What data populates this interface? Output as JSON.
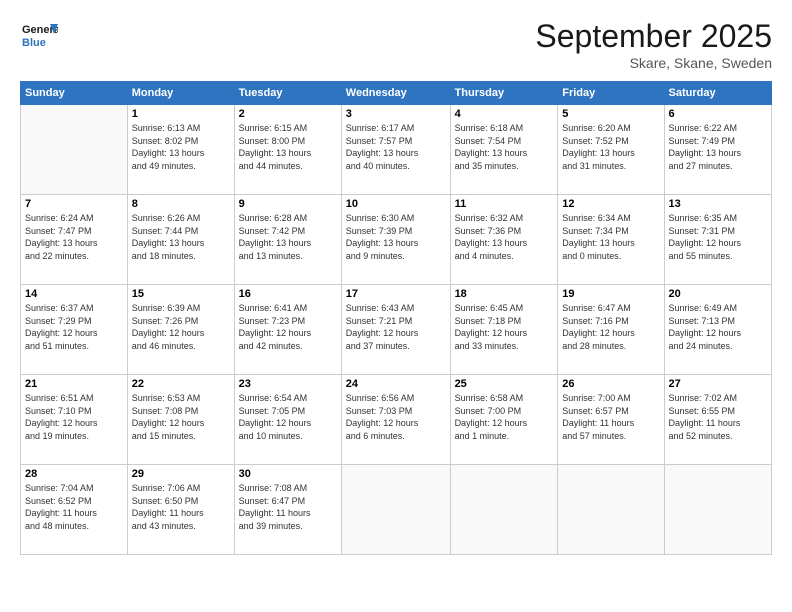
{
  "logo": {
    "text_general": "General",
    "text_blue": "Blue"
  },
  "header": {
    "month_title": "September 2025",
    "subtitle": "Skare, Skane, Sweden"
  },
  "weekdays": [
    "Sunday",
    "Monday",
    "Tuesday",
    "Wednesday",
    "Thursday",
    "Friday",
    "Saturday"
  ],
  "weeks": [
    [
      {
        "day": "",
        "info": ""
      },
      {
        "day": "1",
        "info": "Sunrise: 6:13 AM\nSunset: 8:02 PM\nDaylight: 13 hours\nand 49 minutes."
      },
      {
        "day": "2",
        "info": "Sunrise: 6:15 AM\nSunset: 8:00 PM\nDaylight: 13 hours\nand 44 minutes."
      },
      {
        "day": "3",
        "info": "Sunrise: 6:17 AM\nSunset: 7:57 PM\nDaylight: 13 hours\nand 40 minutes."
      },
      {
        "day": "4",
        "info": "Sunrise: 6:18 AM\nSunset: 7:54 PM\nDaylight: 13 hours\nand 35 minutes."
      },
      {
        "day": "5",
        "info": "Sunrise: 6:20 AM\nSunset: 7:52 PM\nDaylight: 13 hours\nand 31 minutes."
      },
      {
        "day": "6",
        "info": "Sunrise: 6:22 AM\nSunset: 7:49 PM\nDaylight: 13 hours\nand 27 minutes."
      }
    ],
    [
      {
        "day": "7",
        "info": "Sunrise: 6:24 AM\nSunset: 7:47 PM\nDaylight: 13 hours\nand 22 minutes."
      },
      {
        "day": "8",
        "info": "Sunrise: 6:26 AM\nSunset: 7:44 PM\nDaylight: 13 hours\nand 18 minutes."
      },
      {
        "day": "9",
        "info": "Sunrise: 6:28 AM\nSunset: 7:42 PM\nDaylight: 13 hours\nand 13 minutes."
      },
      {
        "day": "10",
        "info": "Sunrise: 6:30 AM\nSunset: 7:39 PM\nDaylight: 13 hours\nand 9 minutes."
      },
      {
        "day": "11",
        "info": "Sunrise: 6:32 AM\nSunset: 7:36 PM\nDaylight: 13 hours\nand 4 minutes."
      },
      {
        "day": "12",
        "info": "Sunrise: 6:34 AM\nSunset: 7:34 PM\nDaylight: 13 hours\nand 0 minutes."
      },
      {
        "day": "13",
        "info": "Sunrise: 6:35 AM\nSunset: 7:31 PM\nDaylight: 12 hours\nand 55 minutes."
      }
    ],
    [
      {
        "day": "14",
        "info": "Sunrise: 6:37 AM\nSunset: 7:29 PM\nDaylight: 12 hours\nand 51 minutes."
      },
      {
        "day": "15",
        "info": "Sunrise: 6:39 AM\nSunset: 7:26 PM\nDaylight: 12 hours\nand 46 minutes."
      },
      {
        "day": "16",
        "info": "Sunrise: 6:41 AM\nSunset: 7:23 PM\nDaylight: 12 hours\nand 42 minutes."
      },
      {
        "day": "17",
        "info": "Sunrise: 6:43 AM\nSunset: 7:21 PM\nDaylight: 12 hours\nand 37 minutes."
      },
      {
        "day": "18",
        "info": "Sunrise: 6:45 AM\nSunset: 7:18 PM\nDaylight: 12 hours\nand 33 minutes."
      },
      {
        "day": "19",
        "info": "Sunrise: 6:47 AM\nSunset: 7:16 PM\nDaylight: 12 hours\nand 28 minutes."
      },
      {
        "day": "20",
        "info": "Sunrise: 6:49 AM\nSunset: 7:13 PM\nDaylight: 12 hours\nand 24 minutes."
      }
    ],
    [
      {
        "day": "21",
        "info": "Sunrise: 6:51 AM\nSunset: 7:10 PM\nDaylight: 12 hours\nand 19 minutes."
      },
      {
        "day": "22",
        "info": "Sunrise: 6:53 AM\nSunset: 7:08 PM\nDaylight: 12 hours\nand 15 minutes."
      },
      {
        "day": "23",
        "info": "Sunrise: 6:54 AM\nSunset: 7:05 PM\nDaylight: 12 hours\nand 10 minutes."
      },
      {
        "day": "24",
        "info": "Sunrise: 6:56 AM\nSunset: 7:03 PM\nDaylight: 12 hours\nand 6 minutes."
      },
      {
        "day": "25",
        "info": "Sunrise: 6:58 AM\nSunset: 7:00 PM\nDaylight: 12 hours\nand 1 minute."
      },
      {
        "day": "26",
        "info": "Sunrise: 7:00 AM\nSunset: 6:57 PM\nDaylight: 11 hours\nand 57 minutes."
      },
      {
        "day": "27",
        "info": "Sunrise: 7:02 AM\nSunset: 6:55 PM\nDaylight: 11 hours\nand 52 minutes."
      }
    ],
    [
      {
        "day": "28",
        "info": "Sunrise: 7:04 AM\nSunset: 6:52 PM\nDaylight: 11 hours\nand 48 minutes."
      },
      {
        "day": "29",
        "info": "Sunrise: 7:06 AM\nSunset: 6:50 PM\nDaylight: 11 hours\nand 43 minutes."
      },
      {
        "day": "30",
        "info": "Sunrise: 7:08 AM\nSunset: 6:47 PM\nDaylight: 11 hours\nand 39 minutes."
      },
      {
        "day": "",
        "info": ""
      },
      {
        "day": "",
        "info": ""
      },
      {
        "day": "",
        "info": ""
      },
      {
        "day": "",
        "info": ""
      }
    ]
  ]
}
